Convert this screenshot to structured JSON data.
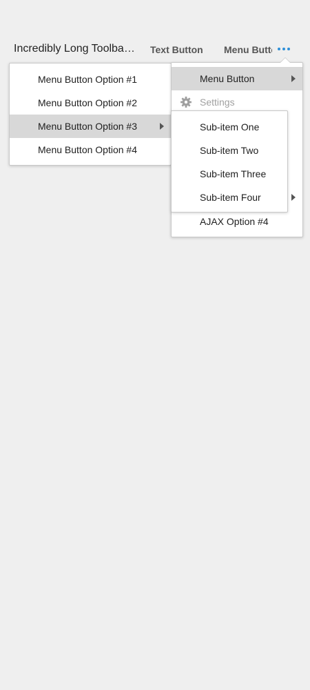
{
  "toolbar": {
    "title": "Incredibly Long Toolbar Title",
    "text_button_label": "Text Button",
    "menu_button_label": "Menu Button",
    "overflow_icon": "more-horizontal-icon",
    "accent_color": "#2e8fd8"
  },
  "main_menu": {
    "items": [
      {
        "label": "Menu Button Option #1"
      },
      {
        "label": "Menu Button Option #2"
      },
      {
        "label": "Menu Button Option #3",
        "has_submenu": true,
        "active": true
      },
      {
        "label": "Menu Button Option #4"
      }
    ]
  },
  "overflow_menu": {
    "items": [
      {
        "label": "Menu Button",
        "has_submenu": true,
        "active": true
      },
      {
        "label": "Settings",
        "icon": "gear-icon",
        "disabled": true
      },
      {
        "label": "AJAX Option #4"
      }
    ]
  },
  "sub_menu": {
    "items": [
      {
        "label": "Sub-item One"
      },
      {
        "label": "Sub-item Two"
      },
      {
        "label": "Sub-item Three"
      },
      {
        "label": "Sub-item Four"
      }
    ]
  }
}
